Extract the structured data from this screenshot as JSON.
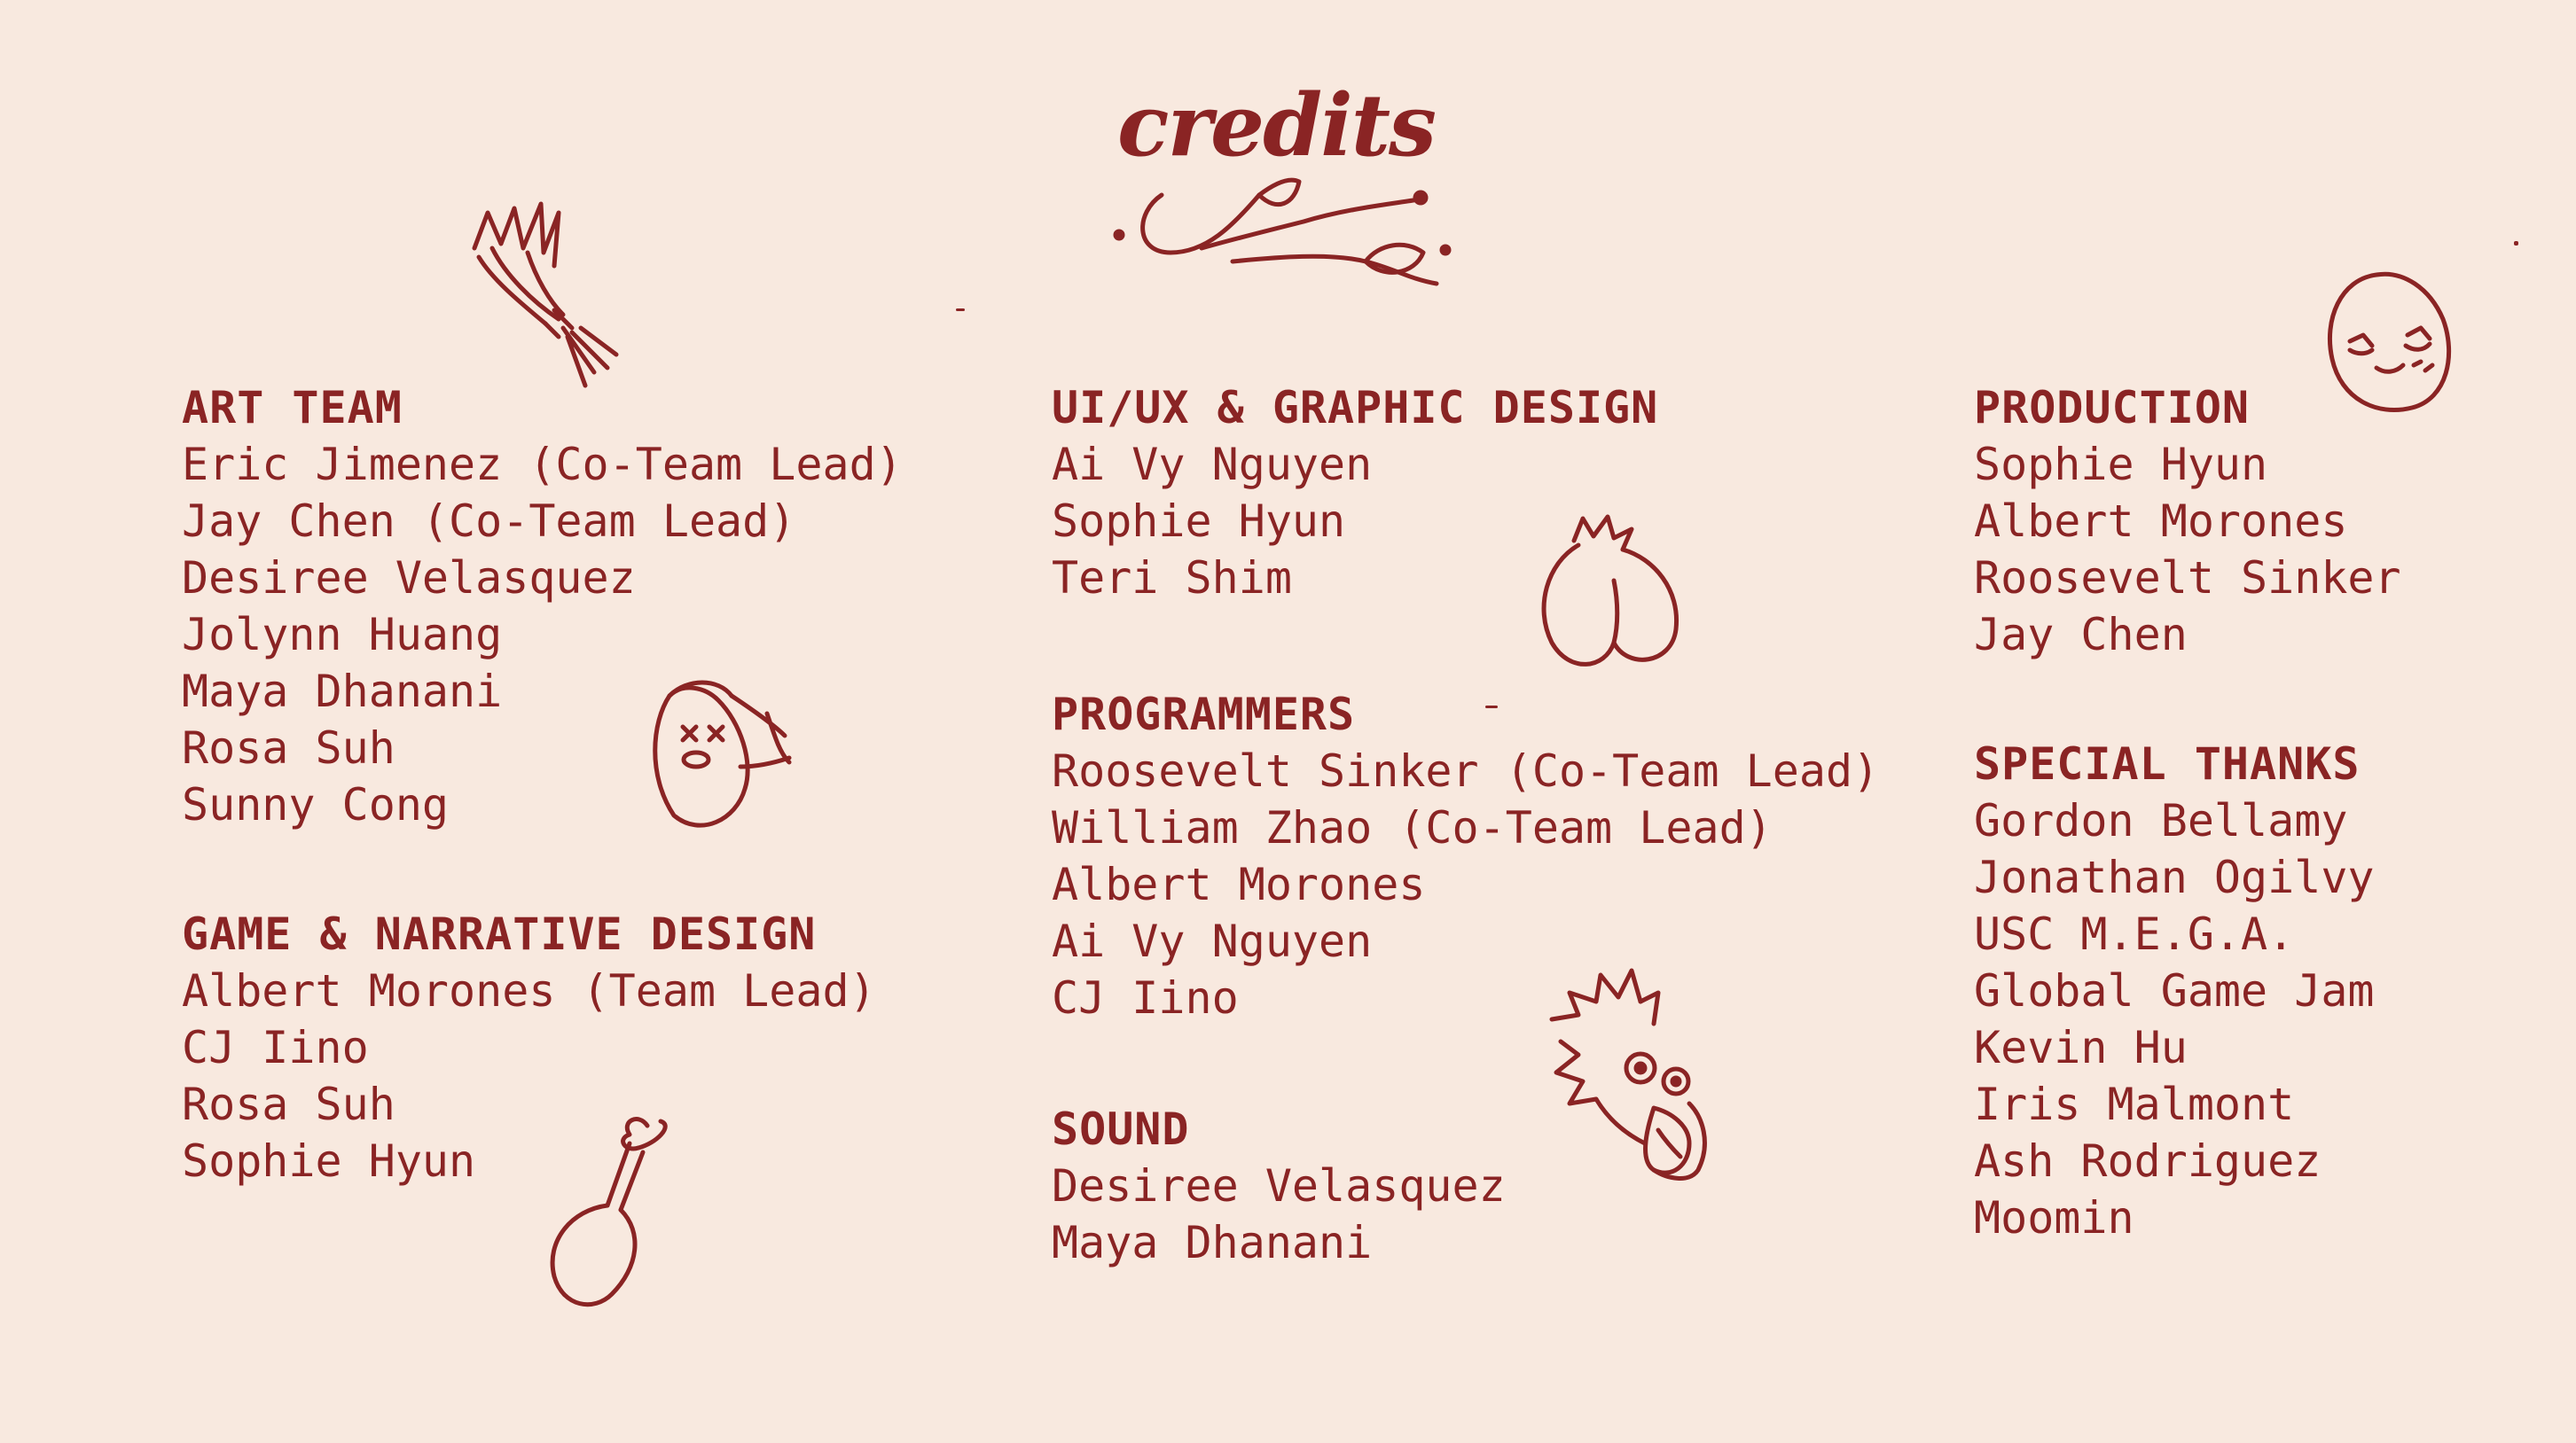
{
  "title": "credits",
  "columns": [
    {
      "sections": [
        {
          "heading": "ART TEAM",
          "members": [
            "Eric Jimenez (Co-Team Lead)",
            "Jay Chen (Co-Team Lead)",
            "Desiree Velasquez",
            "Jolynn Huang",
            "Maya Dhanani",
            "Rosa Suh",
            "Sunny Cong"
          ]
        },
        {
          "heading": "GAME & NARRATIVE DESIGN",
          "members": [
            "Albert Morones (Team Lead)",
            "CJ Iino",
            "Rosa Suh",
            "Sophie Hyun"
          ]
        }
      ]
    },
    {
      "sections": [
        {
          "heading": "UI/UX & GRAPHIC DESIGN",
          "members": [
            "Ai Vy Nguyen",
            "Sophie Hyun",
            "Teri Shim"
          ]
        },
        {
          "heading": "PROGRAMMERS",
          "members": [
            "Roosevelt Sinker (Co-Team Lead)",
            "William Zhao (Co-Team Lead)",
            "Albert Morones",
            "Ai Vy Nguyen",
            "CJ Iino"
          ]
        },
        {
          "heading": "SOUND",
          "members": [
            "Desiree Velasquez",
            "Maya Dhanani"
          ]
        }
      ]
    },
    {
      "sections": [
        {
          "heading": "PRODUCTION",
          "members": [
            "Sophie Hyun",
            "Albert Morones",
            "Roosevelt Sinker",
            "Jay Chen"
          ]
        },
        {
          "heading": "SPECIAL THANKS",
          "members": [
            "Gordon Bellamy",
            "Jonathan Ogilvy",
            "USC M.E.G.A.",
            "Global Game Jam",
            "Kevin Hu",
            "Iris Malmont",
            "Ash Rodriguez",
            "Moomin"
          ]
        }
      ]
    }
  ],
  "doodles": [
    "leek-icon",
    "sad-blob-icon",
    "chicken-leg-icon",
    "fruit-icon",
    "spiky-creature-icon",
    "egg-face-icon",
    "vine-flourish-icon"
  ],
  "colors": {
    "background": "#f8e9df",
    "ink": "#8a2424"
  }
}
